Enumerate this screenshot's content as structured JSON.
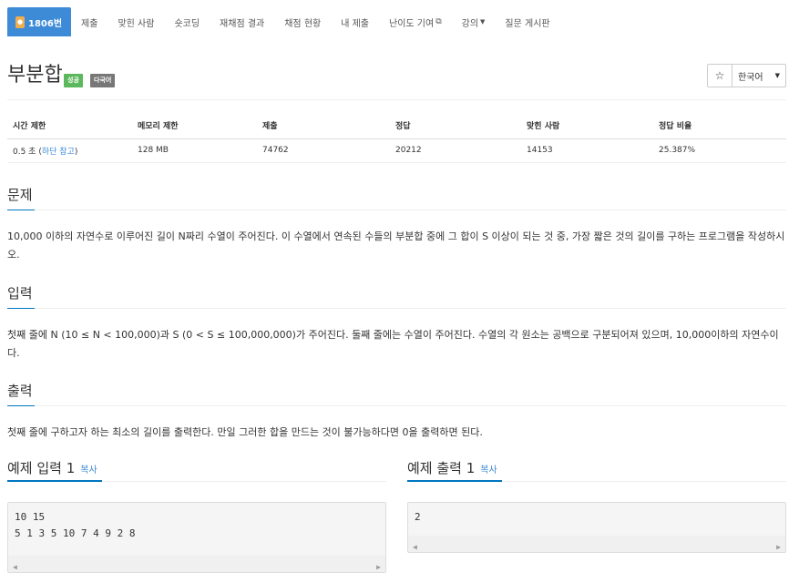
{
  "nav": {
    "problem_number": "1806번",
    "items": [
      "제출",
      "맞힌 사람",
      "숏코딩",
      "재채점 결과",
      "채점 현황",
      "내 제출",
      "난이도 기여",
      "강의",
      "질문 게시판"
    ]
  },
  "problem": {
    "title": "부분합",
    "label_success": "성공",
    "label_multilang": "다국어",
    "star": "☆",
    "language": "한국어"
  },
  "stats": {
    "headers": [
      "시간 제한",
      "메모리 제한",
      "제출",
      "정답",
      "맞힌 사람",
      "정답 비율"
    ],
    "time_limit": "0.5 초 (",
    "time_limit_link": "하단 참고",
    "time_limit_close": ")",
    "memory_limit": "128 MB",
    "submissions": "74762",
    "accepted": "20212",
    "solvers": "14153",
    "ratio": "25.387%"
  },
  "sections": {
    "problem_title": "문제",
    "problem_text": "10,000 이하의 자연수로 이루어진 길이 N짜리 수열이 주어진다. 이 수열에서 연속된 수들의 부분합 중에 그 합이 S 이상이 되는 것 중, 가장 짧은 것의 길이를 구하는 프로그램을 작성하시오.",
    "input_title": "입력",
    "input_text": "첫째 줄에 N (10 ≤ N < 100,000)과 S (0 < S ≤ 100,000,000)가 주어진다. 둘째 줄에는 수열이 주어진다. 수열의 각 원소는 공백으로 구분되어져 있으며, 10,000이하의 자연수이다.",
    "output_title": "출력",
    "output_text": "첫째 줄에 구하고자 하는 최소의 길이를 출력한다. 만일 그러한 합을 만드는 것이 불가능하다면 0을 출력하면 된다."
  },
  "samples": {
    "input_title": "예제 입력 1",
    "output_title": "예제 출력 1",
    "copy_label": "복사",
    "input_line1": "10 15",
    "input_line2": "5 1 3 5 10 7 4 9 2 8",
    "output_line1": "2"
  }
}
